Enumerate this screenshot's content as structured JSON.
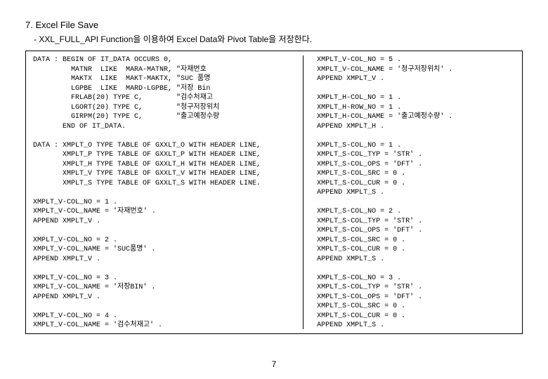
{
  "heading": "7. Excel File Save",
  "subheading": "- XXL_FULL_API Function을 이용하여 Excel Data와 Pivot Table을 저장한다.",
  "page_number": "7",
  "code_left": "DATA : BEGIN OF IT_DATA OCCURS 0,\n         MATNR  LIKE  MARA-MATNR, \"자재번호\n         MAKTX  LIKE  MAKT-MAKTX, \"SUC 품명\n         LGPBE  LIKE  MARD-LGPBE, \"저장 Bin\n         FRLAB(20) TYPE C,        \"검수처재고\n         LGORT(20) TYPE C,        \"청구저장위치\n         GIRPM(20) TYPE C,        \"출고예정수량\n       END OF IT_DATA.\n\nDATA : XMPLT_O TYPE TABLE OF GXXLT_O WITH HEADER LINE,\n       XMPLT_P TYPE TABLE OF GXXLT_P WITH HEADER LINE,\n       XMPLT_H TYPE TABLE OF GXXLT_H WITH HEADER LINE,\n       XMPLT_V TYPE TABLE OF GXXLT_V WITH HEADER LINE,\n       XMPLT_S TYPE TABLE OF GXXLT_S WITH HEADER LINE.\n\nXMPLT_V-COL_NO = 1 .\nXMPLT_V-COL_NAME = '자재번호' .\nAPPEND XMPLT_V .\n\nXMPLT_V-COL_NO = 2 .\nXMPLT_V-COL_NAME = 'SUC품명' .\nAPPEND XMPLT_V .\n\nXMPLT_V-COL_NO = 3 .\nXMPLT_V-COL_NAME = '저장BIN' .\nAPPEND XMPLT_V .\n\nXMPLT_V-COL_NO = 4 .\nXMPLT_V-COL_NAME = '검수처재고' .\nAPPEND XMPLT_V .",
  "code_right": "XMPLT_V-COL_NO = 5 .\nXMPLT_V-COL_NAME = '청구저장위치' .\nAPPEND XMPLT_V .\n\nXMPLT_H-COL_NO = 1 .\nXMPLT_H-ROW_NO = 1 .\nXMPLT_H-COL_NAME = '출고예정수량' .\nAPPEND XMPLT_H .\n\nXMPLT_S-COL_NO = 1 .\nXMPLT_S-COL_TYP = 'STR' .\nXMPLT_S-COL_OPS = 'DFT' .\nXMPLT_S-COL_SRC = 0 .\nXMPLT_S-COL_CUR = 0 .\nAPPEND XMPLT_S .\n\nXMPLT_S-COL_NO = 2 .\nXMPLT_S-COL_TYP = 'STR' .\nXMPLT_S-COL_OPS = 'DFT' .\nXMPLT_S-COL_SRC = 0 .\nXMPLT_S-COL_CUR = 0 .\nAPPEND XMPLT_S .\n\nXMPLT_S-COL_NO = 3 .\nXMPLT_S-COL_TYP = 'STR' .\nXMPLT_S-COL_OPS = 'DFT' .\nXMPLT_S-COL_SRC = 0 .\nXMPLT_S-COL_CUR = 0 .\nAPPEND XMPLT_S ."
}
